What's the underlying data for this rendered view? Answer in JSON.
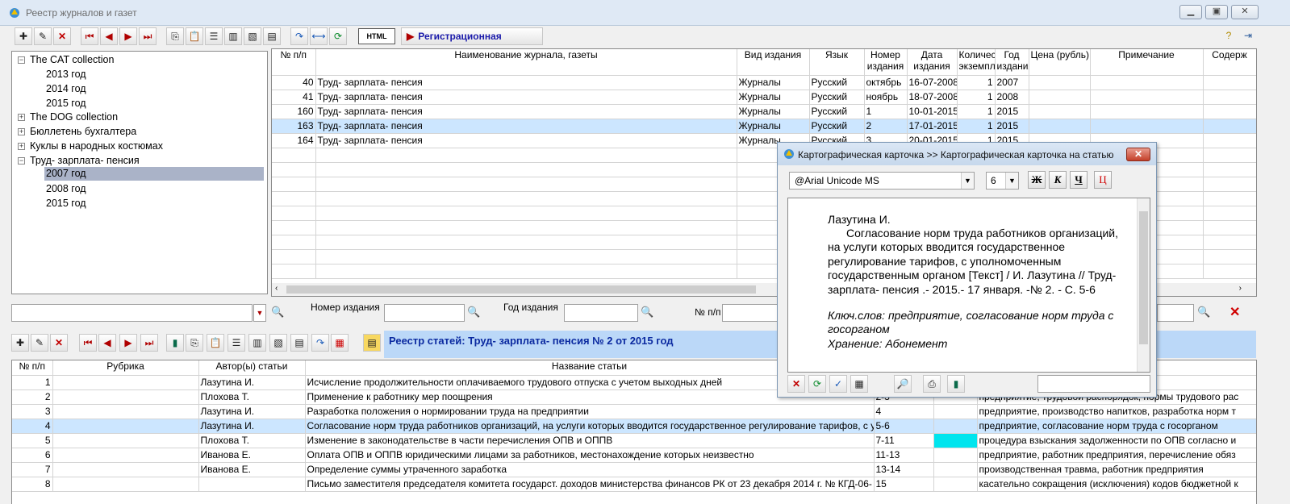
{
  "window": {
    "title": "Реестр журналов и газет"
  },
  "toolbar": {
    "reg_card": "Регистрационная карточка",
    "html_label": "HTML"
  },
  "tree": [
    {
      "label": "The CAT collection",
      "expanded": true
    },
    {
      "label": "2013 год"
    },
    {
      "label": "2014 год"
    },
    {
      "label": "2015 год"
    },
    {
      "label": "The DOG collection",
      "expanded": false
    },
    {
      "label": "Бюллетень бухгалтера",
      "expanded": false
    },
    {
      "label": "Куклы в народных костюмах",
      "expanded": false
    },
    {
      "label": "Труд- зарплата- пенсия",
      "expanded": true
    },
    {
      "label": "2007 год",
      "selected": true
    },
    {
      "label": "2008 год"
    },
    {
      "label": "2015 год"
    }
  ],
  "upper_grid": {
    "headers": [
      "№ п/п",
      "Наименование журнала, газеты",
      "Вид издания",
      "Язык",
      "Номер издания",
      "Дата издания",
      "Количес экземпл",
      "Год издания",
      "Цена (рубль)",
      "Примечание",
      "Содерж"
    ],
    "rows": [
      [
        "40",
        "Труд- зарплата- пенсия",
        "Журналы",
        "Русский",
        "октябрь",
        "16-07-2008",
        "1",
        "2007",
        "",
        "",
        ""
      ],
      [
        "41",
        "Труд- зарплата- пенсия",
        "Журналы",
        "Русский",
        "ноябрь",
        "18-07-2008",
        "1",
        "2008",
        "",
        "",
        ""
      ],
      [
        "160",
        "Труд- зарплата- пенсия",
        "Журналы",
        "Русский",
        "1",
        "10-01-2015",
        "1",
        "2015",
        "",
        "",
        ""
      ],
      [
        "163",
        "Труд- зарплата- пенсия",
        "Журналы",
        "Русский",
        "2",
        "17-01-2015",
        "1",
        "2015",
        "",
        "",
        ""
      ],
      [
        "164",
        "Труд- зарплата- пенсия",
        "Журналы",
        "Русский",
        "3",
        "20-01-2015",
        "1",
        "2015",
        "",
        "",
        ""
      ]
    ],
    "selected_index": 3
  },
  "search": {
    "issue_label": "Номер издания",
    "year_label": "Год издания",
    "num_label": "№ п/п"
  },
  "articles_title": "Реестр статей: Труд- зарплата- пенсия № 2 от 2015 год",
  "lower_grid": {
    "headers": [
      "№ п/п",
      "Рубрика",
      "Автор(ы) статьи",
      "Название статьи",
      "",
      "",
      ""
    ],
    "rows": [
      [
        "1",
        "",
        "Лазутина И.",
        "Исчисление продолжительности оплачиваемого трудового отпуска с учетом выходных дней",
        "",
        "",
        "ов, исчисление, п"
      ],
      [
        "2",
        "",
        "Плохова Т.",
        "Применение к работнику мер поощрения",
        "2-3",
        "",
        "предприятие, трудовой распорядок, нормы трудового рас"
      ],
      [
        "3",
        "",
        "Лазутина И.",
        "Разработка положения о нормировании труда на предприятии",
        "4",
        "",
        "предприятие, производство напитков, разработка норм т"
      ],
      [
        "4",
        "",
        "Лазутина И.",
        "Согласование норм труда работников организаций, на услуги которых вводится государственное регулирование тарифов, с уп",
        "5-6",
        "",
        "предприятие, согласование норм труда с госорганом"
      ],
      [
        "5",
        "",
        "Плохова Т.",
        "Изменение в законодательстве в части перечисления ОПВ и ОППВ",
        "7-11",
        "",
        "процедура взыскания задолженности по ОПВ согласно и"
      ],
      [
        "6",
        "",
        "Иванова Е.",
        "Оплата ОПВ и ОППВ юридическими лицами за работников, местонахождение которых неизвестно",
        "11-13",
        "",
        "предприятие, работник предприятия, перечисление обяз"
      ],
      [
        "7",
        "",
        "Иванова Е.",
        "Определение суммы утраченного заработка",
        "13-14",
        "",
        "производственная травма, работник предприятия"
      ],
      [
        "8",
        "",
        "",
        "Письмо заместителя председателя комитета государст. доходов министерства финансов РК от 23 декабря 2014 г. № КГД-06-",
        "15",
        "",
        "касательно сокращения (исключения) кодов бюджетной к"
      ]
    ],
    "selected_index": 3
  },
  "card": {
    "title": "Картографическая карточка >> Картографическая карточка на статью",
    "font": "@Arial Unicode MS",
    "size": "6",
    "fmt_buttons": [
      "Ж",
      "К",
      "Ч",
      "Ц"
    ],
    "text_author": "Лазутина И.",
    "text_body1": "Согласование норм труда работников организаций,",
    "text_body2": "на услуги которых вводится государственное",
    "text_body3": "регулирование тарифов, с уполномоченным",
    "text_body4": "государственным органом [Текст] / И. Лазутина  // Труд-",
    "text_body5": "зарплата- пенсия .- 2015.- 17 января. -№ 2. - С. 5-6",
    "keywords1": "Ключ.слов: предприятие, согласование норм труда с",
    "keywords2": "госорганом",
    "storage": "Хранение: Абонемент"
  }
}
